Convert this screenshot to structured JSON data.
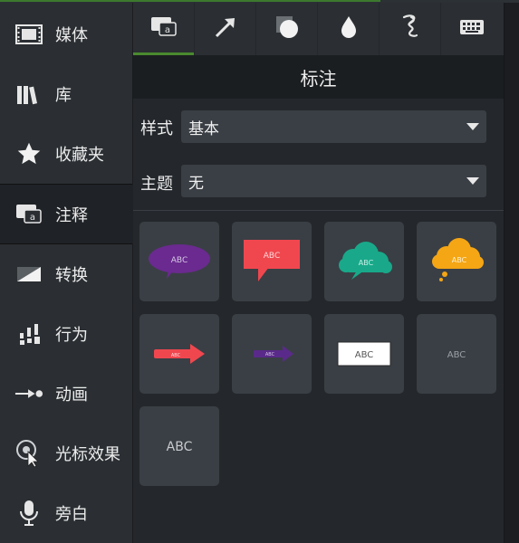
{
  "sidebar": {
    "items": [
      {
        "label": "媒体",
        "icon": "film-icon"
      },
      {
        "label": "库",
        "icon": "library-books-icon"
      },
      {
        "label": "收藏夹",
        "icon": "star-icon"
      },
      {
        "label": "注释",
        "icon": "callout-icon",
        "active": true
      },
      {
        "label": "转换",
        "icon": "transition-icon"
      },
      {
        "label": "行为",
        "icon": "behavior-icon"
      },
      {
        "label": "动画",
        "icon": "animation-arrow-icon"
      },
      {
        "label": "光标效果",
        "icon": "cursor-effect-icon"
      },
      {
        "label": "旁白",
        "icon": "microphone-icon"
      }
    ]
  },
  "tabs": [
    {
      "icon": "callout-tab-icon",
      "active": true
    },
    {
      "icon": "arrow-tab-icon"
    },
    {
      "icon": "shape-tab-icon"
    },
    {
      "icon": "blur-drop-tab-icon"
    },
    {
      "icon": "sketch-motion-tab-icon"
    },
    {
      "icon": "keyboard-tab-icon"
    }
  ],
  "panel": {
    "title": "标注",
    "style": {
      "label": "样式",
      "value": "基本"
    },
    "theme": {
      "label": "主题",
      "value": "无"
    }
  },
  "callouts": [
    {
      "kind": "speech-bubble",
      "text": "ABC",
      "color": "#6a2a8f"
    },
    {
      "kind": "square-bubble",
      "text": "ABC",
      "color": "#f0474f"
    },
    {
      "kind": "cloud-bubble",
      "text": "ABC",
      "color": "#19a98a"
    },
    {
      "kind": "thought-cloud",
      "text": "ABC",
      "color": "#f5a614"
    },
    {
      "kind": "arrow",
      "text": "ABC",
      "color": "#f0474f"
    },
    {
      "kind": "arrow-small",
      "text": "ABC",
      "color": "#5a2a8a"
    },
    {
      "kind": "box",
      "text": "ABC",
      "color": "#ffffff"
    },
    {
      "kind": "text-small",
      "text": "ABC",
      "color": "#9aa0a6"
    },
    {
      "kind": "text-large",
      "text": "ABC",
      "color": "#c8cbce"
    }
  ]
}
